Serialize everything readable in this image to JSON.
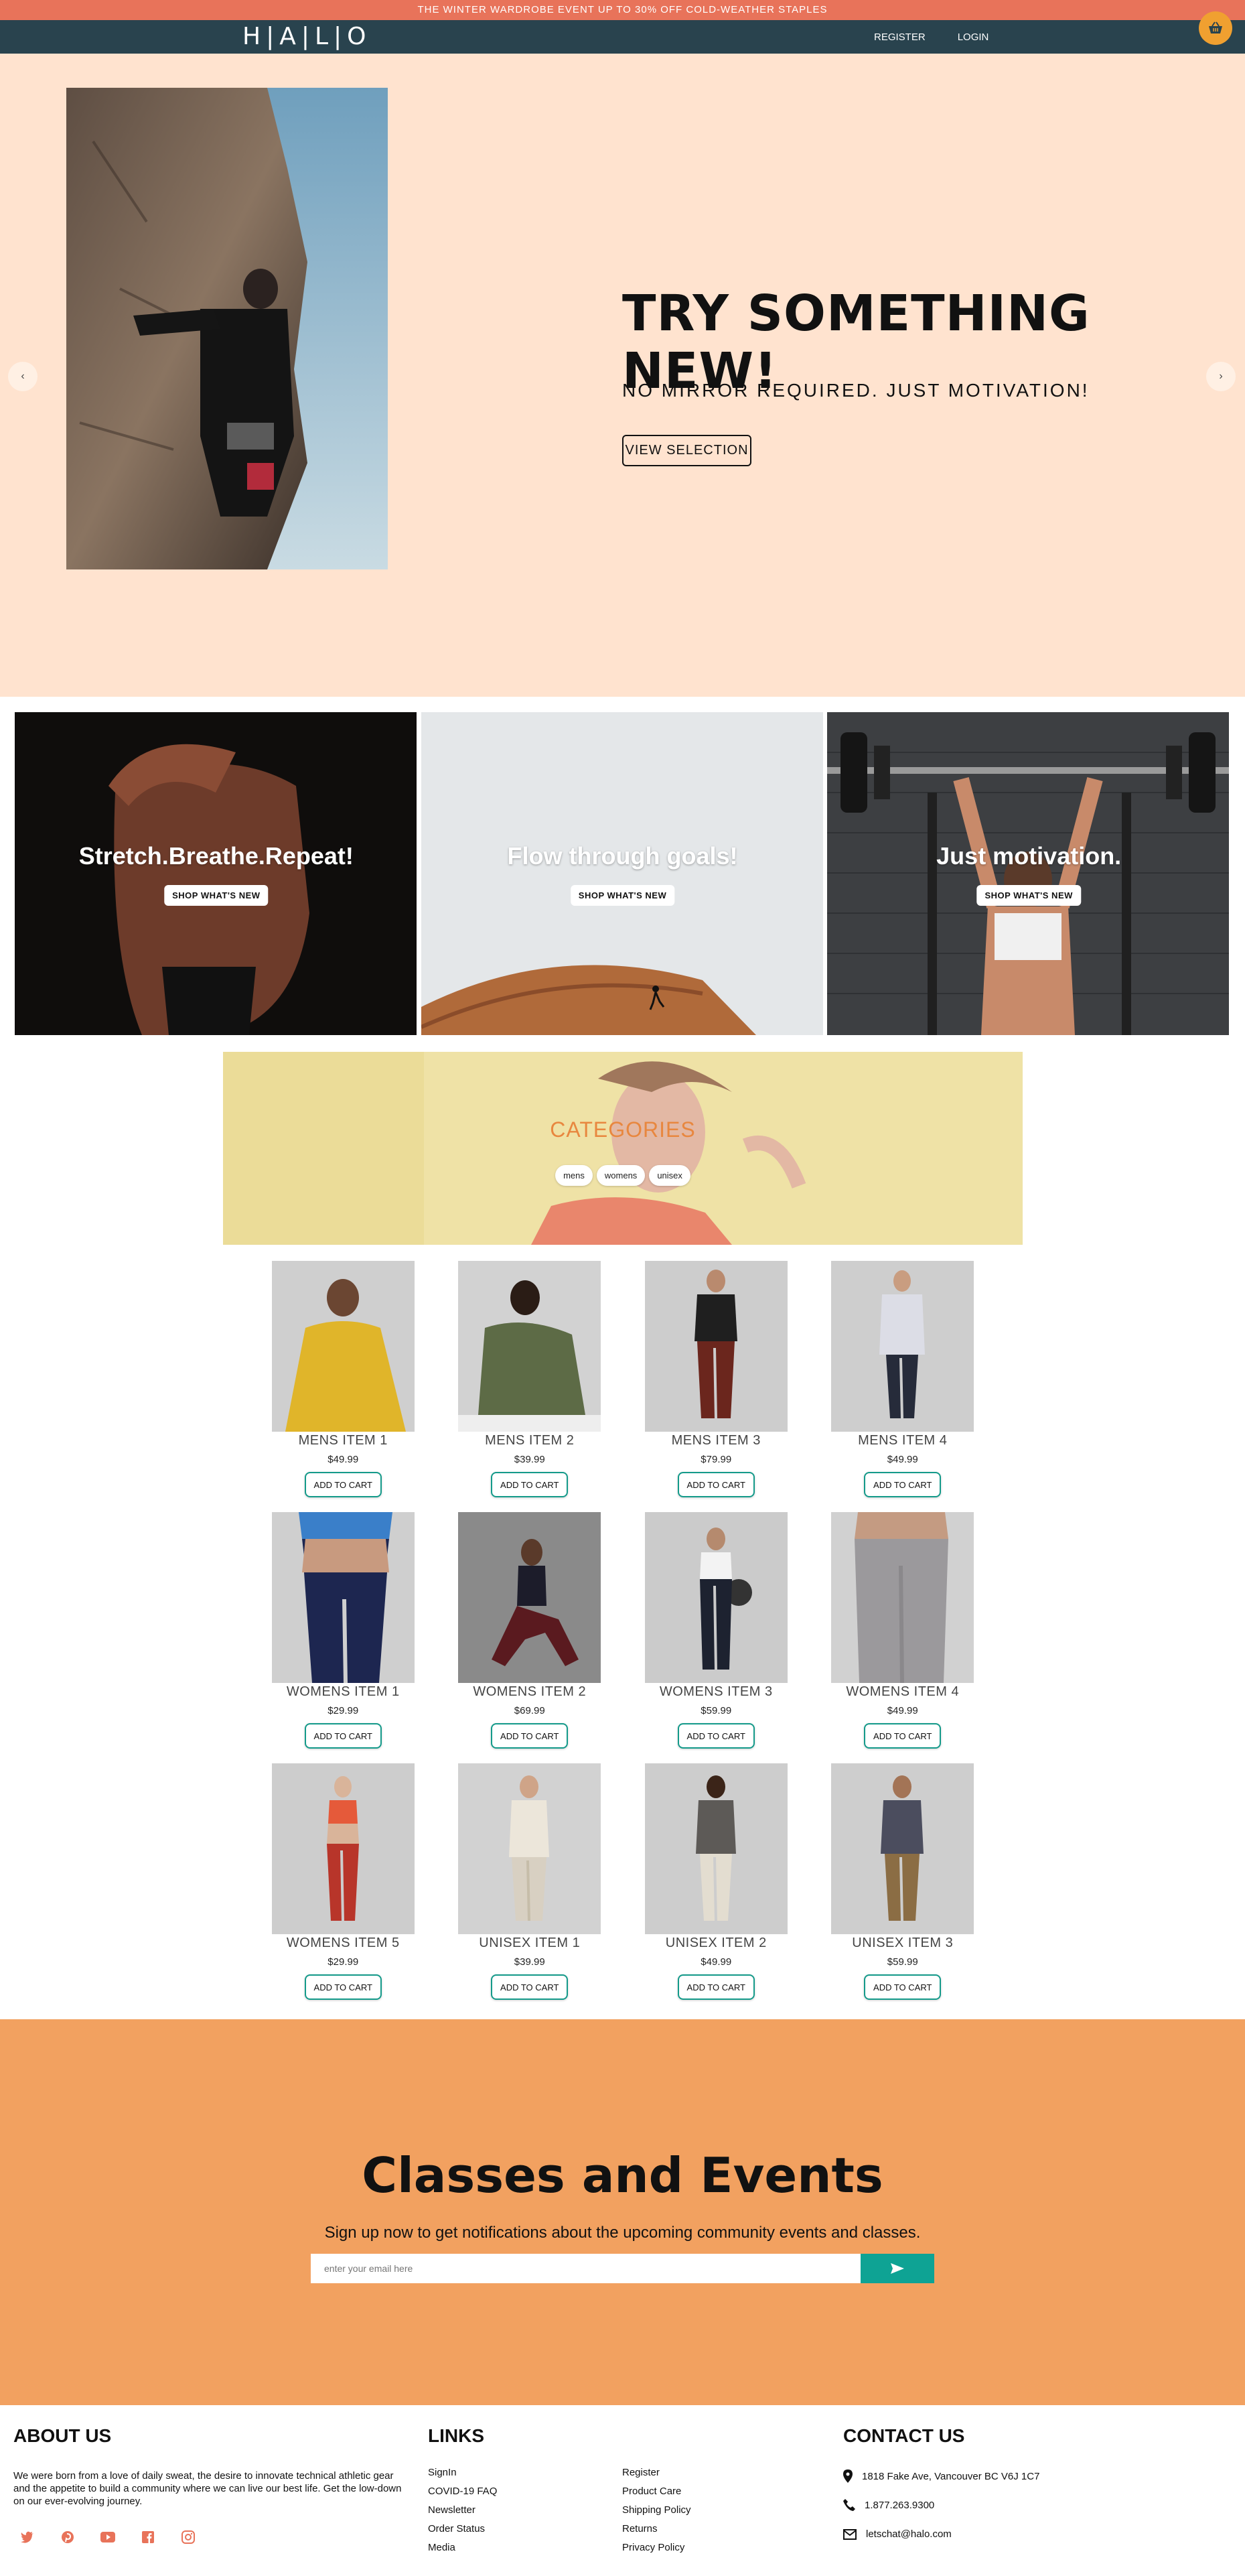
{
  "announcement": "THE WINTER WARDROBE EVENT UP TO 30% OFF COLD-WEATHER STAPLES",
  "header": {
    "logo": "H|A|L|O",
    "register": "REGISTER",
    "login": "LOGIN",
    "cart_icon": "basket-icon"
  },
  "hero": {
    "title": "TRY SOMETHING NEW!",
    "subtitle": "NO MIRROR REQUIRED. JUST MOTIVATION!",
    "button": "VIEW SELECTION",
    "prev_icon": "‹",
    "next_icon": "›"
  },
  "promos": [
    {
      "title": "Stretch.Breathe.Repeat!",
      "button": "SHOP WHAT'S NEW"
    },
    {
      "title": "Flow through goals!",
      "button": "SHOP WHAT'S NEW"
    },
    {
      "title": "Just motivation.",
      "button": "SHOP WHAT'S NEW"
    }
  ],
  "categories": {
    "title": "CATEGORIES",
    "items": [
      "mens",
      "womens",
      "unisex"
    ]
  },
  "products": [
    {
      "name": "MENS ITEM 1",
      "price": "$49.99",
      "button": "ADD TO CART"
    },
    {
      "name": "MENS ITEM 2",
      "price": "$39.99",
      "button": "ADD TO CART"
    },
    {
      "name": "MENS ITEM 3",
      "price": "$79.99",
      "button": "ADD TO CART"
    },
    {
      "name": "MENS ITEM 4",
      "price": "$49.99",
      "button": "ADD TO CART"
    },
    {
      "name": "WOMENS ITEM 1",
      "price": "$29.99",
      "button": "ADD TO CART"
    },
    {
      "name": "WOMENS ITEM 2",
      "price": "$69.99",
      "button": "ADD TO CART"
    },
    {
      "name": "WOMENS ITEM 3",
      "price": "$59.99",
      "button": "ADD TO CART"
    },
    {
      "name": "WOMENS ITEM 4",
      "price": "$49.99",
      "button": "ADD TO CART"
    },
    {
      "name": "WOMENS ITEM 5",
      "price": "$29.99",
      "button": "ADD TO CART"
    },
    {
      "name": "UNISEX ITEM 1",
      "price": "$39.99",
      "button": "ADD TO CART"
    },
    {
      "name": "UNISEX ITEM 2",
      "price": "$49.99",
      "button": "ADD TO CART"
    },
    {
      "name": "UNISEX ITEM 3",
      "price": "$59.99",
      "button": "ADD TO CART"
    }
  ],
  "classes": {
    "title": "Classes and Events",
    "subtitle": "Sign up now to get notifications about the upcoming community events and classes.",
    "email_placeholder": "enter your email here",
    "send_icon": "send-icon"
  },
  "footer": {
    "about": {
      "heading": "ABOUT US",
      "text": "We were born from a love of daily sweat, the desire to innovate technical athletic gear and the appetite to build a community where we can live our best life. Get the low-down on our ever-evolving journey.",
      "socials": [
        "twitter-icon",
        "pinterest-icon",
        "youtube-icon",
        "facebook-icon",
        "instagram-icon"
      ]
    },
    "links": {
      "heading": "LINKS",
      "col1": [
        "SignIn",
        "COVID-19 FAQ",
        "Newsletter",
        "Order Status",
        "Media"
      ],
      "col2": [
        "Register",
        "Product Care",
        "Shipping Policy",
        "Returns",
        "Privacy Policy"
      ]
    },
    "contact": {
      "heading": "CONTACT US",
      "address": "1818 Fake Ave, Vancouver BC V6J 1C7",
      "phone": "1.877.263.9300",
      "email": "letschat@halo.com"
    }
  },
  "colors": {
    "accent": "#e8735a",
    "nav": "#29434e",
    "hero_bg": "#ffe3cf",
    "teal": "#149a8a",
    "classes_bg": "#f2a160"
  }
}
